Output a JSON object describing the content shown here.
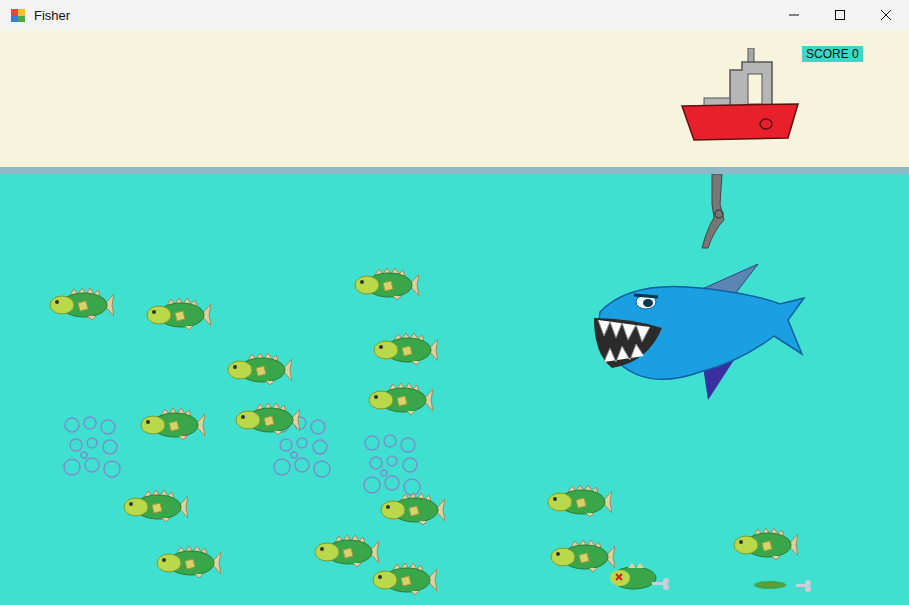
{
  "window": {
    "title": "Fisher"
  },
  "score": "SCORE 0",
  "fish": [
    {
      "kind": "alive"
    },
    {
      "kind": "alive"
    },
    {
      "kind": "alive"
    },
    {
      "kind": "alive"
    },
    {
      "kind": "alive"
    },
    {
      "kind": "alive"
    },
    {
      "kind": "alive"
    },
    {
      "kind": "alive"
    },
    {
      "kind": "alive"
    },
    {
      "kind": "alive"
    },
    {
      "kind": "alive"
    },
    {
      "kind": "alive"
    },
    {
      "kind": "alive"
    },
    {
      "kind": "alive"
    },
    {
      "kind": "alive"
    },
    {
      "kind": "alive"
    },
    {
      "kind": "dead"
    },
    {
      "kind": "bones"
    }
  ]
}
